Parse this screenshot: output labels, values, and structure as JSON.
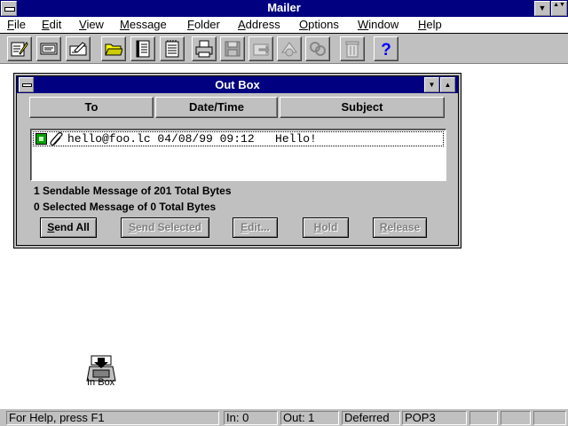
{
  "app": {
    "title": "Mailer"
  },
  "titlebar": {
    "minimize_glyph": "▼",
    "maximize_glyph": "▲▼"
  },
  "menubar": {
    "items": [
      "File",
      "Edit",
      "View",
      "Message",
      "Folder",
      "Address",
      "Options",
      "Window",
      "Help"
    ]
  },
  "toolbar": {
    "buttons": [
      {
        "icon": "compose-icon",
        "enabled": true
      },
      {
        "icon": "reply-icon",
        "enabled": true
      },
      {
        "icon": "forward-icon",
        "enabled": true
      },
      {
        "icon": "folder-icon",
        "enabled": true
      },
      {
        "icon": "address-book-icon",
        "enabled": true
      },
      {
        "icon": "notepad-icon",
        "enabled": true
      },
      {
        "icon": "printer-icon",
        "enabled": true
      },
      {
        "icon": "save-icon",
        "enabled": false
      },
      {
        "icon": "move-icon",
        "enabled": false
      },
      {
        "icon": "attach-icon",
        "enabled": false
      },
      {
        "icon": "link-icon",
        "enabled": false
      },
      {
        "icon": "trash-icon",
        "enabled": false
      },
      {
        "icon": "help-icon",
        "enabled": true
      }
    ]
  },
  "outbox": {
    "title": "Out Box",
    "minimize_glyph": "▼",
    "maximize_glyph": "▲",
    "columns": [
      "To",
      "Date/Time",
      "Subject"
    ],
    "messages": [
      {
        "to": "hello@foo.lc",
        "datetime": "04/08/99 09:12",
        "subject": "Hello!"
      }
    ],
    "row_text": "hello@foo.lc 04/08/99 09:12   Hello!",
    "sendable_info": "1 Sendable Message of 201 Total Bytes",
    "selected_info": "0 Selected Message of 0 Total Bytes",
    "buttons": {
      "send_all": "Send All",
      "send_selected": "Send Selected",
      "edit": "Edit...",
      "hold": "Hold",
      "release": "Release"
    }
  },
  "desktop": {
    "inbox_label": "In Box"
  },
  "statusbar": {
    "help": "For Help, press F1",
    "in": "In:  0",
    "out": "Out: 1",
    "state": "Deferred",
    "protocol": "POP3"
  },
  "colors": {
    "title_bar": "#000080",
    "face": "#c0c0c0",
    "desktop": "#ffffff",
    "help_icon": "#0000ff"
  }
}
